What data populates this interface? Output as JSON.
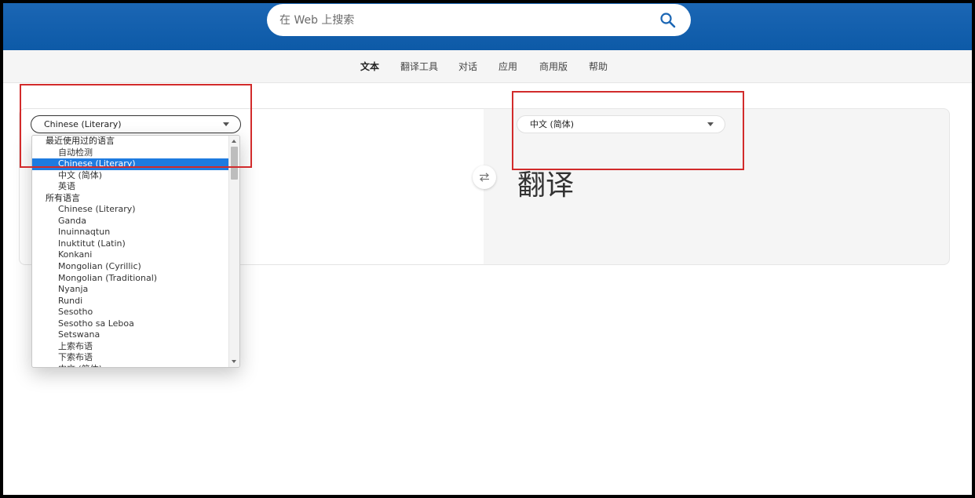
{
  "search": {
    "placeholder": "在 Web 上搜索",
    "icon": "search-icon"
  },
  "nav": {
    "items": [
      {
        "label": "文本",
        "active": true
      },
      {
        "label": "翻译工具"
      },
      {
        "label": "对话"
      },
      {
        "label": "应用"
      },
      {
        "label": "商用版"
      },
      {
        "label": "帮助"
      }
    ]
  },
  "translator": {
    "source_language": "Chinese (Literary)",
    "target_language": "中文 (简体)",
    "output_text": "翻译",
    "swap_icon": "swap-icon"
  },
  "dropdown": {
    "rows": [
      {
        "type": "group",
        "label": "最近使用过的语言"
      },
      {
        "type": "option",
        "label": "自动检测"
      },
      {
        "type": "option",
        "label": "Chinese (Literary)",
        "selected": true
      },
      {
        "type": "option",
        "label": "中文 (简体)"
      },
      {
        "type": "option",
        "label": "英语"
      },
      {
        "type": "group",
        "label": "所有语言"
      },
      {
        "type": "option",
        "label": "Chinese (Literary)"
      },
      {
        "type": "option",
        "label": "Ganda"
      },
      {
        "type": "option",
        "label": "Inuinnaqtun"
      },
      {
        "type": "option",
        "label": "Inuktitut (Latin)"
      },
      {
        "type": "option",
        "label": "Konkani"
      },
      {
        "type": "option",
        "label": "Mongolian (Cyrillic)"
      },
      {
        "type": "option",
        "label": "Mongolian (Traditional)"
      },
      {
        "type": "option",
        "label": "Nyanja"
      },
      {
        "type": "option",
        "label": "Rundi"
      },
      {
        "type": "option",
        "label": "Sesotho"
      },
      {
        "type": "option",
        "label": "Sesotho sa Leboa"
      },
      {
        "type": "option",
        "label": "Setswana"
      },
      {
        "type": "option",
        "label": "上索布语"
      },
      {
        "type": "option",
        "label": "下索布语"
      },
      {
        "type": "option",
        "label": "中文 (简体)"
      }
    ]
  },
  "colors": {
    "header": "#0d5aa7",
    "highlight": "#1e7be0",
    "annotation": "#d22b2b"
  }
}
